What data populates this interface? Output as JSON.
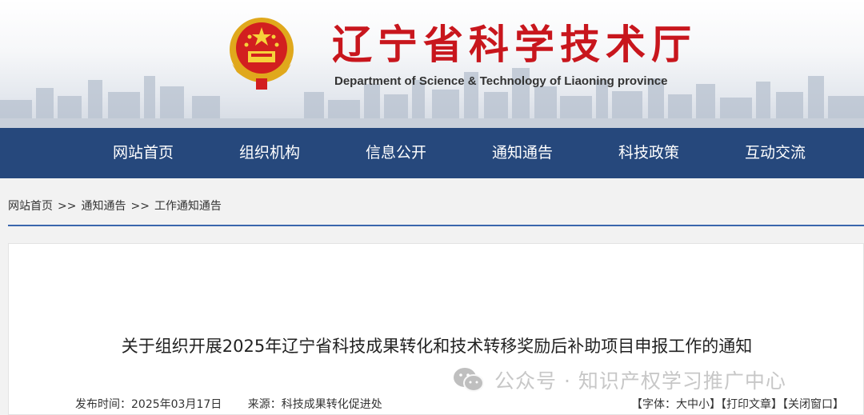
{
  "header": {
    "title": "辽宁省科学技术厅",
    "subtitle": "Department of Science & Technology of Liaoning province",
    "colors": {
      "title_red": "#c8161d",
      "nav_blue": "#26487c"
    }
  },
  "nav": {
    "items": [
      "网站首页",
      "组织机构",
      "信息公开",
      "通知通告",
      "科技政策",
      "互动交流"
    ]
  },
  "breadcrumb": {
    "items": [
      "网站首页",
      ">>",
      "通知通告",
      ">>",
      "工作通知通告"
    ]
  },
  "article": {
    "title": "关于组织开展2025年辽宁省科技成果转化和技术转移奖励后补助项目申报工作的通知",
    "publish_label": "发布时间：",
    "publish_date": "2025年03月17日",
    "source_label": "来源：",
    "source": "科技成果转化促进处",
    "tools": {
      "font_size": "【字体：大中小】",
      "print": "【打印文章】",
      "close": "【关闭窗口】"
    }
  },
  "watermark": {
    "text": "公众号 · 知识产权学习推广中心",
    "icon": "wechat-icon"
  }
}
